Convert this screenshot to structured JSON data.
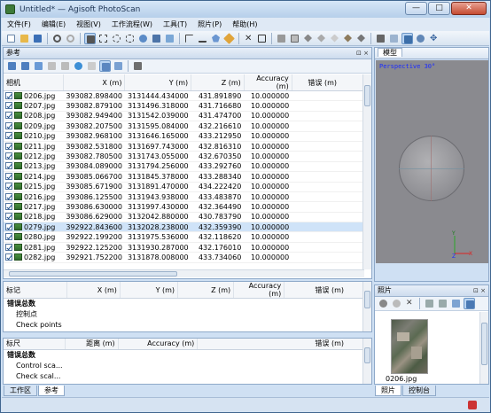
{
  "window": {
    "title": "Untitled* — Agisoft PhotoScan",
    "min": "—",
    "max": "□",
    "close": "✕"
  },
  "menu": [
    "文件(F)",
    "编辑(E)",
    "视图(V)",
    "工作流程(W)",
    "工具(T)",
    "照片(P)",
    "帮助(H)"
  ],
  "reference": {
    "title": "参考",
    "controls": "⊡ ×",
    "columns": [
      "相机",
      "X (m)",
      "Y (m)",
      "Z (m)",
      "Accuracy (m)",
      "错误 (m)"
    ],
    "rows": [
      {
        "name": "0206.jpg",
        "x": "393082.898400",
        "y": "3131444.434000",
        "z": "431.891890",
        "acc": "10.000000",
        "err": ""
      },
      {
        "name": "0207.jpg",
        "x": "393082.879100",
        "y": "3131496.318000",
        "z": "431.716680",
        "acc": "10.000000",
        "err": ""
      },
      {
        "name": "0208.jpg",
        "x": "393082.949400",
        "y": "3131542.039000",
        "z": "431.474700",
        "acc": "10.000000",
        "err": ""
      },
      {
        "name": "0209.jpg",
        "x": "393082.207500",
        "y": "3131595.084000",
        "z": "432.216610",
        "acc": "10.000000",
        "err": ""
      },
      {
        "name": "0210.jpg",
        "x": "393082.968100",
        "y": "3131646.165000",
        "z": "433.212950",
        "acc": "10.000000",
        "err": ""
      },
      {
        "name": "0211.jpg",
        "x": "393082.531800",
        "y": "3131697.743000",
        "z": "432.816310",
        "acc": "10.000000",
        "err": ""
      },
      {
        "name": "0212.jpg",
        "x": "393082.780500",
        "y": "3131743.055000",
        "z": "432.670350",
        "acc": "10.000000",
        "err": ""
      },
      {
        "name": "0213.jpg",
        "x": "393084.089000",
        "y": "3131794.256000",
        "z": "433.292760",
        "acc": "10.000000",
        "err": ""
      },
      {
        "name": "0214.jpg",
        "x": "393085.066700",
        "y": "3131845.378000",
        "z": "433.288340",
        "acc": "10.000000",
        "err": ""
      },
      {
        "name": "0215.jpg",
        "x": "393085.671900",
        "y": "3131891.470000",
        "z": "434.222420",
        "acc": "10.000000",
        "err": ""
      },
      {
        "name": "0216.jpg",
        "x": "393086.125500",
        "y": "3131943.938000",
        "z": "433.483870",
        "acc": "10.000000",
        "err": ""
      },
      {
        "name": "0217.jpg",
        "x": "393086.630000",
        "y": "3131997.430000",
        "z": "432.364490",
        "acc": "10.000000",
        "err": ""
      },
      {
        "name": "0218.jpg",
        "x": "393086.629000",
        "y": "3132042.880000",
        "z": "430.783790",
        "acc": "10.000000",
        "err": ""
      },
      {
        "name": "0279.jpg",
        "x": "392922.843600",
        "y": "3132028.238000",
        "z": "432.359390",
        "acc": "10.000000",
        "err": ""
      },
      {
        "name": "0280.jpg",
        "x": "392922.199200",
        "y": "3131975.536000",
        "z": "432.118620",
        "acc": "10.000000",
        "err": ""
      },
      {
        "name": "0281.jpg",
        "x": "392922.125200",
        "y": "3131930.287000",
        "z": "432.176010",
        "acc": "10.000000",
        "err": ""
      },
      {
        "name": "0282.jpg",
        "x": "392921.752200",
        "y": "3131878.008000",
        "z": "433.734060",
        "acc": "10.000000",
        "err": ""
      }
    ]
  },
  "markers": {
    "columns": [
      "标记",
      "X (m)",
      "Y (m)",
      "Z (m)",
      "Accuracy (m)",
      "错误 (m)"
    ],
    "total": "错误总数",
    "items": [
      "控制点",
      "Check points"
    ]
  },
  "scalebars": {
    "columns": [
      "标尺",
      "距离 (m)",
      "Accuracy (m)",
      "错误 (m)"
    ],
    "total": "错误总数",
    "items": [
      "Control sca...",
      "Check scal..."
    ]
  },
  "left_tabs": [
    "工作区",
    "参考"
  ],
  "model": {
    "title": "模型",
    "label": "Perspective 30°",
    "axes": {
      "y": "Y",
      "z": "Z",
      "x": "X"
    }
  },
  "photos": {
    "title": "照片",
    "thumb_label": "0206.jpg"
  },
  "right_tabs": [
    "照片",
    "控制台"
  ]
}
